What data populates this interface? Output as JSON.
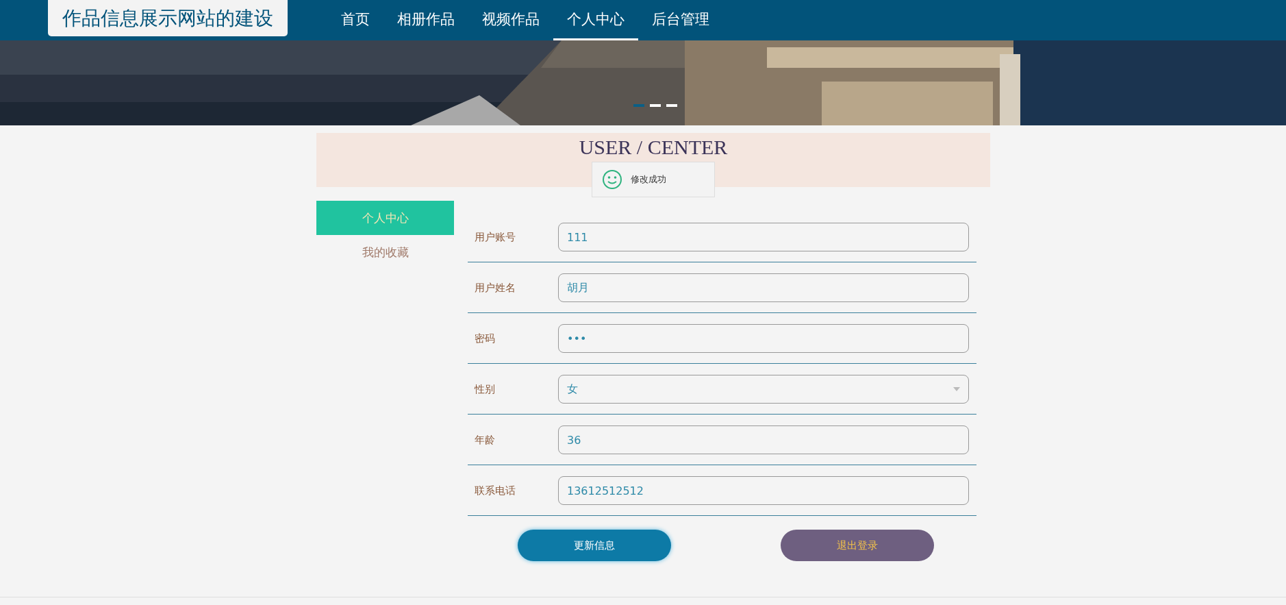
{
  "site_title": "作品信息展示网站的建设",
  "nav": [
    {
      "label": "首页",
      "selected": false
    },
    {
      "label": "相册作品",
      "selected": false
    },
    {
      "label": "视频作品",
      "selected": false
    },
    {
      "label": "个人中心",
      "selected": true
    },
    {
      "label": "后台管理",
      "selected": false
    }
  ],
  "banner": {
    "kind": "picture",
    "dots": [
      {
        "selected": true
      },
      {
        "selected": false
      },
      {
        "selected": false
      }
    ]
  },
  "section_title": "USER / CENTER",
  "toast": {
    "message": "修改成功"
  },
  "sidebar": {
    "items": [
      {
        "label": "个人中心",
        "selected": true
      },
      {
        "label": "我的收藏",
        "selected": false
      }
    ]
  },
  "form": {
    "fields": [
      {
        "label": "用户账号",
        "kind": "text",
        "value": "111"
      },
      {
        "label": "用户姓名",
        "kind": "text",
        "value": "胡月"
      },
      {
        "label": "密码",
        "kind": "password",
        "value": "•••"
      },
      {
        "label": "性别",
        "kind": "select",
        "value": "女"
      },
      {
        "label": "年龄",
        "kind": "text",
        "value": "36"
      },
      {
        "label": "联系电话",
        "kind": "text",
        "value": "13612512512"
      }
    ],
    "buttons": [
      {
        "label": "更新信息",
        "kind": "primary"
      },
      {
        "label": "退出登录",
        "kind": "secondary"
      }
    ]
  }
}
